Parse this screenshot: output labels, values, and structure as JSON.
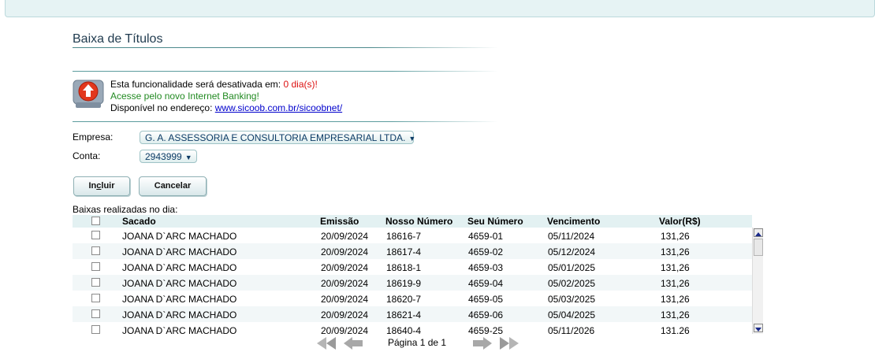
{
  "page": {
    "title": "Baixa de Títulos"
  },
  "notice": {
    "line1_prefix": "Esta funcionalidade será desativada em: ",
    "line1_days": "0 dia(s)!",
    "line2": "Acesse pelo novo Internet Banking!",
    "line3_prefix": "Disponível no endereço: ",
    "line3_link": "www.sicoob.com.br/sicoobnet/",
    "icon": "upload-alert-icon"
  },
  "form": {
    "empresa_label": "Empresa:",
    "empresa_value": "G. A. ASSESSORIA E CONSULTORIA EMPRESARIAL LTDA.",
    "conta_label": "Conta:",
    "conta_value": "2943999",
    "caret": "▼"
  },
  "buttons": {
    "incluir_prefix": "In",
    "incluir_underline": "c",
    "incluir_suffix": "luir",
    "cancelar": "Cancelar"
  },
  "grid": {
    "label": "Baixas realizadas no dia:",
    "headers": [
      "Sacado",
      "Emissão",
      "Nosso Número",
      "Seu Número",
      "Vencimento",
      "Valor(R$)"
    ],
    "rows": [
      [
        "JOANA D`ARC MACHADO",
        "20/09/2024",
        "18616-7",
        "4659-01",
        "05/11/2024",
        "131,26"
      ],
      [
        "JOANA D`ARC MACHADO",
        "20/09/2024",
        "18617-4",
        "4659-02",
        "05/12/2024",
        "131,26"
      ],
      [
        "JOANA D`ARC MACHADO",
        "20/09/2024",
        "18618-1",
        "4659-03",
        "05/01/2025",
        "131,26"
      ],
      [
        "JOANA D`ARC MACHADO",
        "20/09/2024",
        "18619-9",
        "4659-04",
        "05/02/2025",
        "131,26"
      ],
      [
        "JOANA D`ARC MACHADO",
        "20/09/2024",
        "18620-7",
        "4659-05",
        "05/03/2025",
        "131,26"
      ],
      [
        "JOANA D`ARC MACHADO",
        "20/09/2024",
        "18621-4",
        "4659-06",
        "05/04/2025",
        "131,26"
      ],
      [
        "JOANA D`ARC MACHADO",
        "20/09/2024",
        "18640-4",
        "4659-25",
        "05/11/2026",
        "131,26"
      ]
    ]
  },
  "pager": {
    "text": "Página 1 de 1"
  },
  "colors": {
    "accent": "#4d8a8c",
    "alert_red": "#dd1111",
    "alert_green": "#228a22",
    "link": "#0000cc",
    "header_bg": "#e3f1f2"
  }
}
